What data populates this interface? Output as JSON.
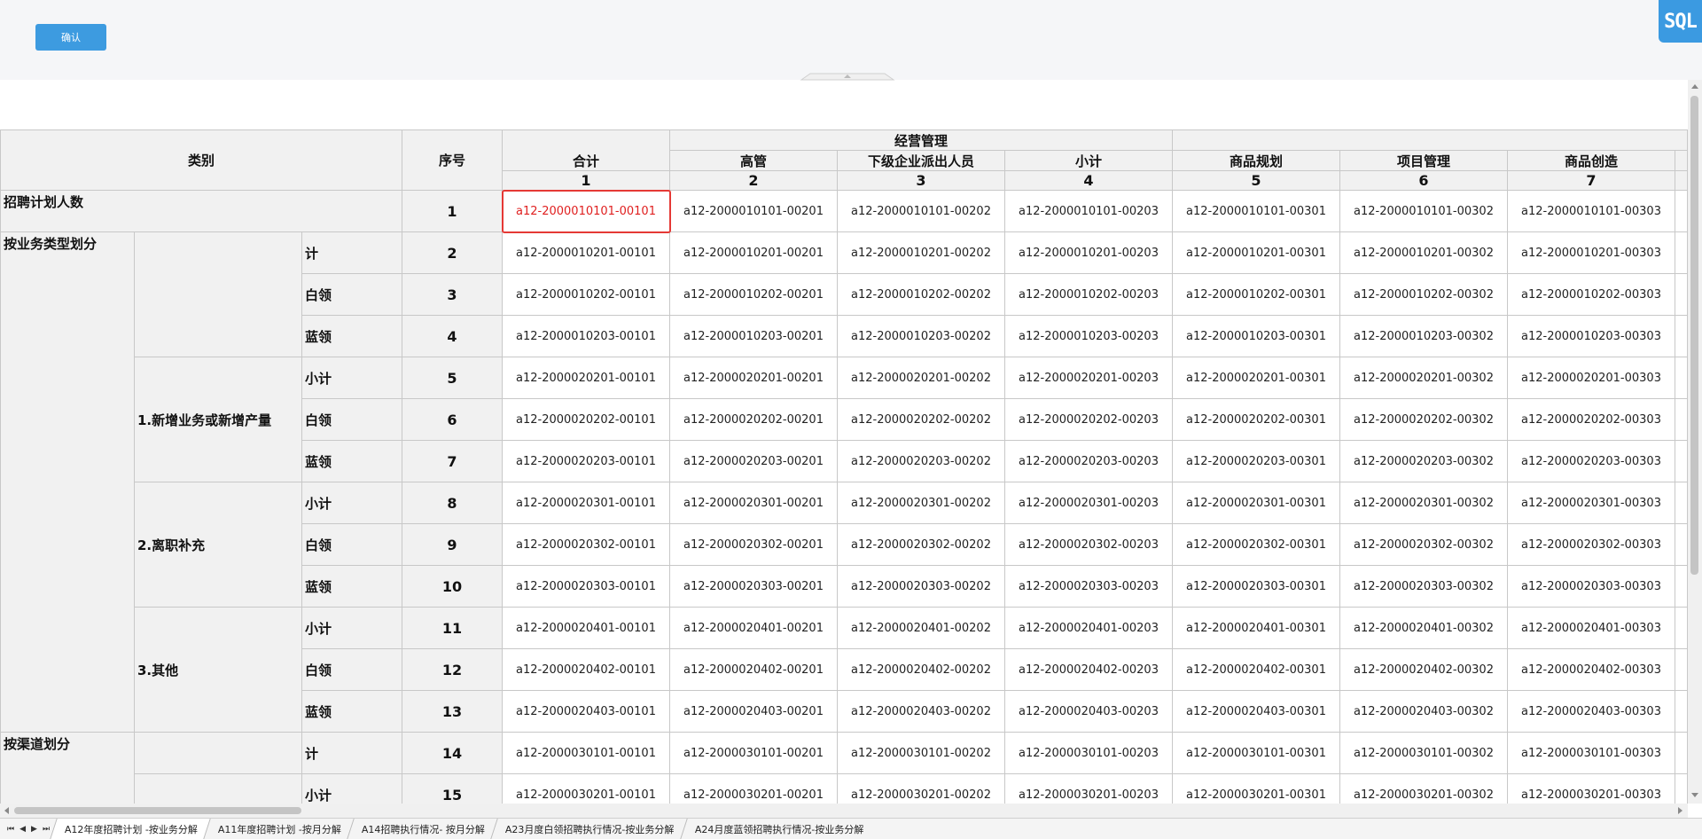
{
  "toolbar": {
    "confirm_label": "确认",
    "sql_label": "SQL"
  },
  "table": {
    "headers": {
      "category": "类别",
      "seq": "序号",
      "total": "合计",
      "group_jygl": "经营管理",
      "cols": [
        "高管",
        "下级企业派出人员",
        "小计",
        "商品规划",
        "项目管理",
        "商品创造"
      ],
      "col_numbers": [
        "1",
        "2",
        "3",
        "4",
        "5",
        "6",
        "7"
      ]
    },
    "sections": {
      "zhaopin": "招聘计划人数",
      "byType": "按业务类型划分",
      "byChannel": "按渠道划分",
      "sub1": "1.新增业务或新增产量",
      "sub2": "2.离职补充",
      "sub3": "3.其他"
    },
    "rows": [
      {
        "label": "",
        "seq": "1",
        "cells": [
          "a12-2000010101-00101",
          "a12-2000010101-00201",
          "a12-2000010101-00202",
          "a12-2000010101-00203",
          "a12-2000010101-00301",
          "a12-2000010101-00302",
          "a12-2000010101-00303"
        ]
      },
      {
        "label": "计",
        "seq": "2",
        "cells": [
          "a12-2000010201-00101",
          "a12-2000010201-00201",
          "a12-2000010201-00202",
          "a12-2000010201-00203",
          "a12-2000010201-00301",
          "a12-2000010201-00302",
          "a12-2000010201-00303"
        ]
      },
      {
        "label": "白领",
        "seq": "3",
        "cells": [
          "a12-2000010202-00101",
          "a12-2000010202-00201",
          "a12-2000010202-00202",
          "a12-2000010202-00203",
          "a12-2000010202-00301",
          "a12-2000010202-00302",
          "a12-2000010202-00303"
        ]
      },
      {
        "label": "蓝领",
        "seq": "4",
        "cells": [
          "a12-2000010203-00101",
          "a12-2000010203-00201",
          "a12-2000010203-00202",
          "a12-2000010203-00203",
          "a12-2000010203-00301",
          "a12-2000010203-00302",
          "a12-2000010203-00303"
        ]
      },
      {
        "label": "小计",
        "seq": "5",
        "cells": [
          "a12-2000020201-00101",
          "a12-2000020201-00201",
          "a12-2000020201-00202",
          "a12-2000020201-00203",
          "a12-2000020201-00301",
          "a12-2000020201-00302",
          "a12-2000020201-00303"
        ]
      },
      {
        "label": "白领",
        "seq": "6",
        "cells": [
          "a12-2000020202-00101",
          "a12-2000020202-00201",
          "a12-2000020202-00202",
          "a12-2000020202-00203",
          "a12-2000020202-00301",
          "a12-2000020202-00302",
          "a12-2000020202-00303"
        ]
      },
      {
        "label": "蓝领",
        "seq": "7",
        "cells": [
          "a12-2000020203-00101",
          "a12-2000020203-00201",
          "a12-2000020203-00202",
          "a12-2000020203-00203",
          "a12-2000020203-00301",
          "a12-2000020203-00302",
          "a12-2000020203-00303"
        ]
      },
      {
        "label": "小计",
        "seq": "8",
        "cells": [
          "a12-2000020301-00101",
          "a12-2000020301-00201",
          "a12-2000020301-00202",
          "a12-2000020301-00203",
          "a12-2000020301-00301",
          "a12-2000020301-00302",
          "a12-2000020301-00303"
        ]
      },
      {
        "label": "白领",
        "seq": "9",
        "cells": [
          "a12-2000020302-00101",
          "a12-2000020302-00201",
          "a12-2000020302-00202",
          "a12-2000020302-00203",
          "a12-2000020302-00301",
          "a12-2000020302-00302",
          "a12-2000020302-00303"
        ]
      },
      {
        "label": "蓝领",
        "seq": "10",
        "cells": [
          "a12-2000020303-00101",
          "a12-2000020303-00201",
          "a12-2000020303-00202",
          "a12-2000020303-00203",
          "a12-2000020303-00301",
          "a12-2000020303-00302",
          "a12-2000020303-00303"
        ]
      },
      {
        "label": "小计",
        "seq": "11",
        "cells": [
          "a12-2000020401-00101",
          "a12-2000020401-00201",
          "a12-2000020401-00202",
          "a12-2000020401-00203",
          "a12-2000020401-00301",
          "a12-2000020401-00302",
          "a12-2000020401-00303"
        ]
      },
      {
        "label": "白领",
        "seq": "12",
        "cells": [
          "a12-2000020402-00101",
          "a12-2000020402-00201",
          "a12-2000020402-00202",
          "a12-2000020402-00203",
          "a12-2000020402-00301",
          "a12-2000020402-00302",
          "a12-2000020402-00303"
        ]
      },
      {
        "label": "蓝领",
        "seq": "13",
        "cells": [
          "a12-2000020403-00101",
          "a12-2000020403-00201",
          "a12-2000020403-00202",
          "a12-2000020403-00203",
          "a12-2000020403-00301",
          "a12-2000020403-00302",
          "a12-2000020403-00303"
        ]
      },
      {
        "label": "计",
        "seq": "14",
        "cells": [
          "a12-2000030101-00101",
          "a12-2000030101-00201",
          "a12-2000030101-00202",
          "a12-2000030101-00203",
          "a12-2000030101-00301",
          "a12-2000030101-00302",
          "a12-2000030101-00303"
        ]
      },
      {
        "label": "小计",
        "seq": "15",
        "cells": [
          "a12-2000030201-00101",
          "a12-2000030201-00201",
          "a12-2000030201-00202",
          "a12-2000030201-00203",
          "a12-2000030201-00301",
          "a12-2000030201-00302",
          "a12-2000030201-00303"
        ]
      }
    ]
  },
  "sheet_tabs": [
    "A12年度招聘计划 -按业务分解",
    "A11年度招聘计划 -按月分解",
    "A14招聘执行情况- 按月分解",
    "A23月度白领招聘执行情况-按业务分解",
    "A24月度蓝领招聘执行情况-按业务分解"
  ],
  "colors": {
    "accent": "#3d9be0",
    "selection": "#e53935"
  }
}
